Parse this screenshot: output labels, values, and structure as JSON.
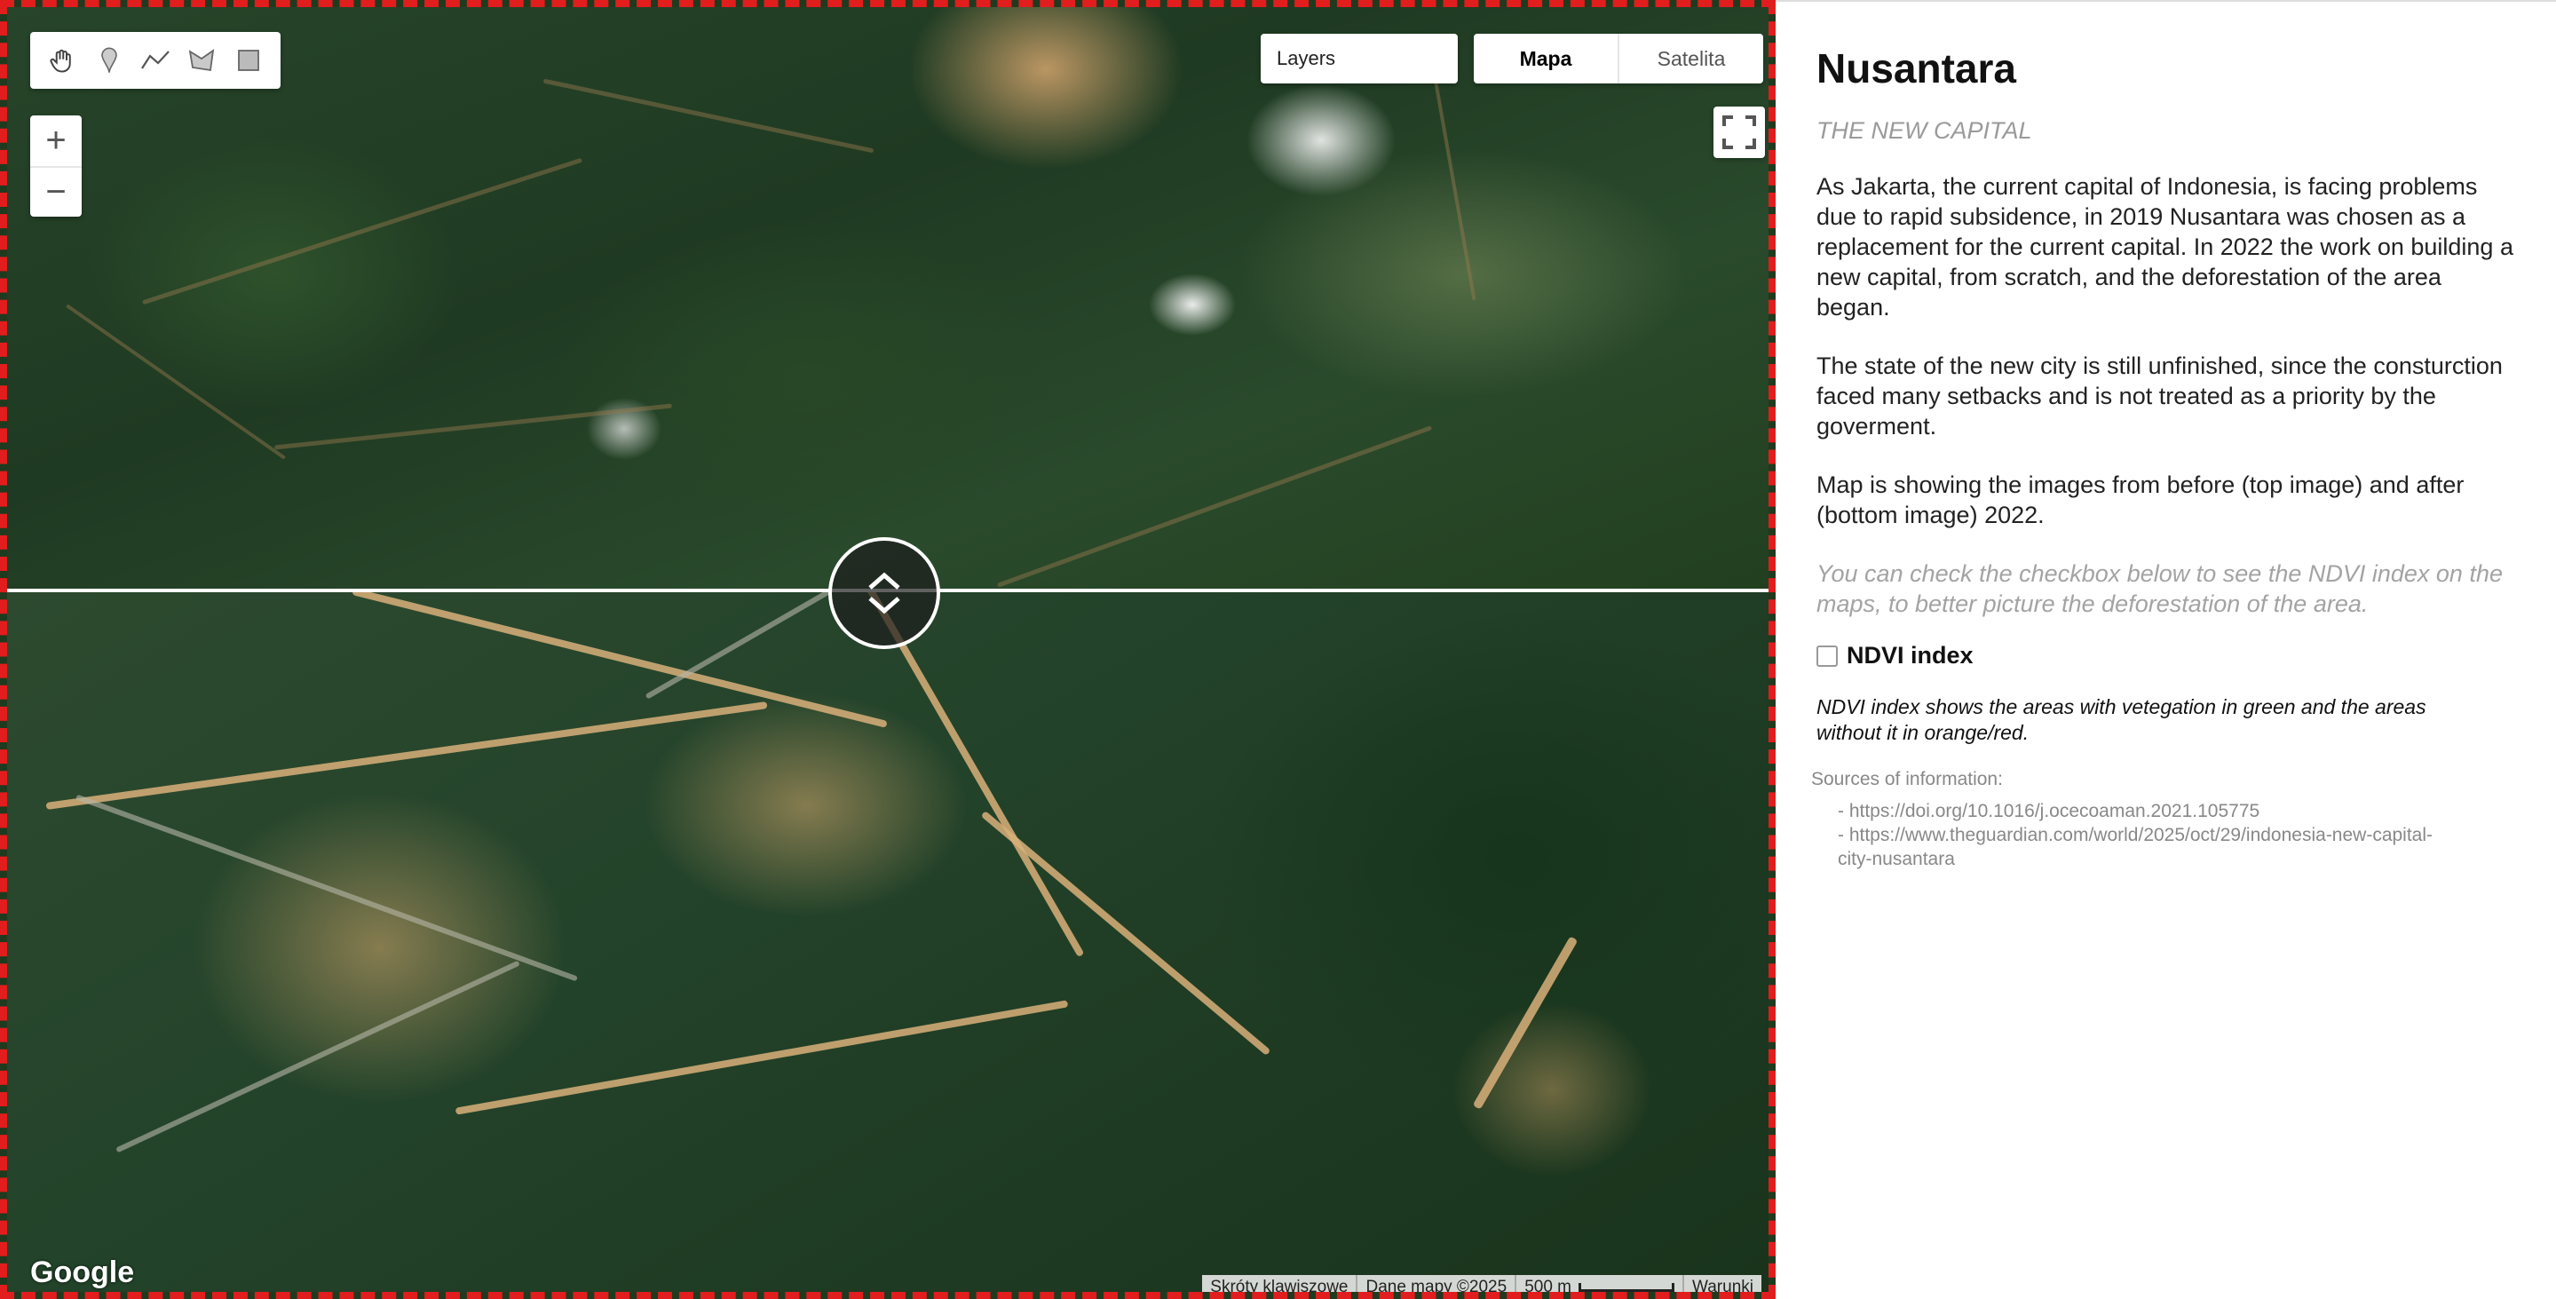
{
  "map": {
    "layers_label": "Layers",
    "map_type": {
      "options": [
        "Mapa",
        "Satelita"
      ],
      "selected": "Mapa"
    },
    "zoom": {
      "in": "+",
      "out": "−"
    },
    "tools": [
      "hand-icon",
      "marker-icon",
      "polyline-icon",
      "polygon-icon",
      "rectangle-icon"
    ],
    "google_logo": "Google",
    "attribution": {
      "shortcuts": "Skróty klawiszowe",
      "map_data": "Dane mapy ©2025",
      "scale": "500 m",
      "terms": "Warunki"
    },
    "frame_color": "#e11d1d",
    "swipe_position": 0.45
  },
  "sidebar": {
    "title": "Nusantara",
    "subtitle": "THE NEW CAPITAL",
    "paragraphs": [
      "As Jakarta, the current capital of Indonesia, is facing problems due to rapid subsidence, in 2019 Nusantara was chosen as a replacement for the current capital. In 2022 the work on building a new capital, from scratch, and the deforestation of the area began.",
      "The state of the new city is still unfinished, since the consturction faced many setbacks and is not treated as a priority by the goverment.",
      "Map is showing the images from before (top image) and after (bottom image) 2022."
    ],
    "hint": "You can check the checkbox below to see the NDVI index on the maps, to better picture the deforestation of the area.",
    "checkbox": {
      "label": "NDVI index",
      "checked": false
    },
    "note": "NDVI index shows the areas with vetegation in green and the areas without it in orange/red.",
    "sources_title": "Sources of information:",
    "sources": [
      "- https://doi.org/10.1016/j.ocecoaman.2021.105775",
      "- https://www.theguardian.com/world/2025/oct/29/indonesia-new-capital-city-nusantara"
    ]
  }
}
